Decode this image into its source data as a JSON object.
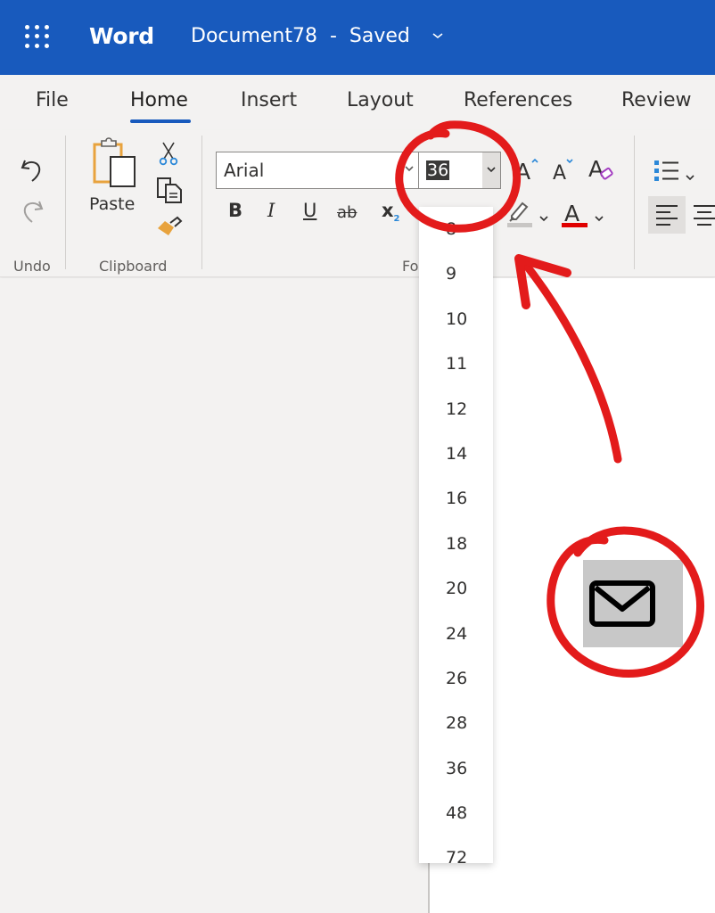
{
  "titlebar": {
    "app_launcher_icon": "waffle-grid-icon",
    "app_name": "Word",
    "document_title": "Document78  -  Saved",
    "title_menu_chevron": "⌄",
    "background_color": "#185abd"
  },
  "tabs": [
    {
      "label": "File",
      "active": false
    },
    {
      "label": "Home",
      "active": true
    },
    {
      "label": "Insert",
      "active": false
    },
    {
      "label": "Layout",
      "active": false
    },
    {
      "label": "References",
      "active": false
    },
    {
      "label": "Review",
      "active": false
    }
  ],
  "ribbon": {
    "groups": {
      "undo": "Undo",
      "clipboard": "Clipboard",
      "font": "Fo"
    },
    "clipboard": {
      "paste_label": "Paste"
    },
    "font": {
      "font_name": "Arial",
      "font_size": "36",
      "chevron": "⌄",
      "bold": "B",
      "italic": "I",
      "underline": "U",
      "strikethrough": "ab",
      "subscript": "x",
      "subscript_sub": "2"
    },
    "colors": {
      "highlight": "#c8c6c4",
      "font_color": "#e00000",
      "accent": "#185abd"
    }
  },
  "font_size_dropdown": {
    "options": [
      "8",
      "9",
      "10",
      "11",
      "12",
      "14",
      "16",
      "18",
      "20",
      "24",
      "26",
      "28",
      "36",
      "48",
      "72"
    ],
    "selected": "36"
  },
  "floating_button": {
    "icon": "mail-icon"
  },
  "annotations": {
    "color": "#e31b1b",
    "items": [
      "circle-around-font-size",
      "arrow-to-font-size",
      "circle-around-mail-button"
    ]
  }
}
